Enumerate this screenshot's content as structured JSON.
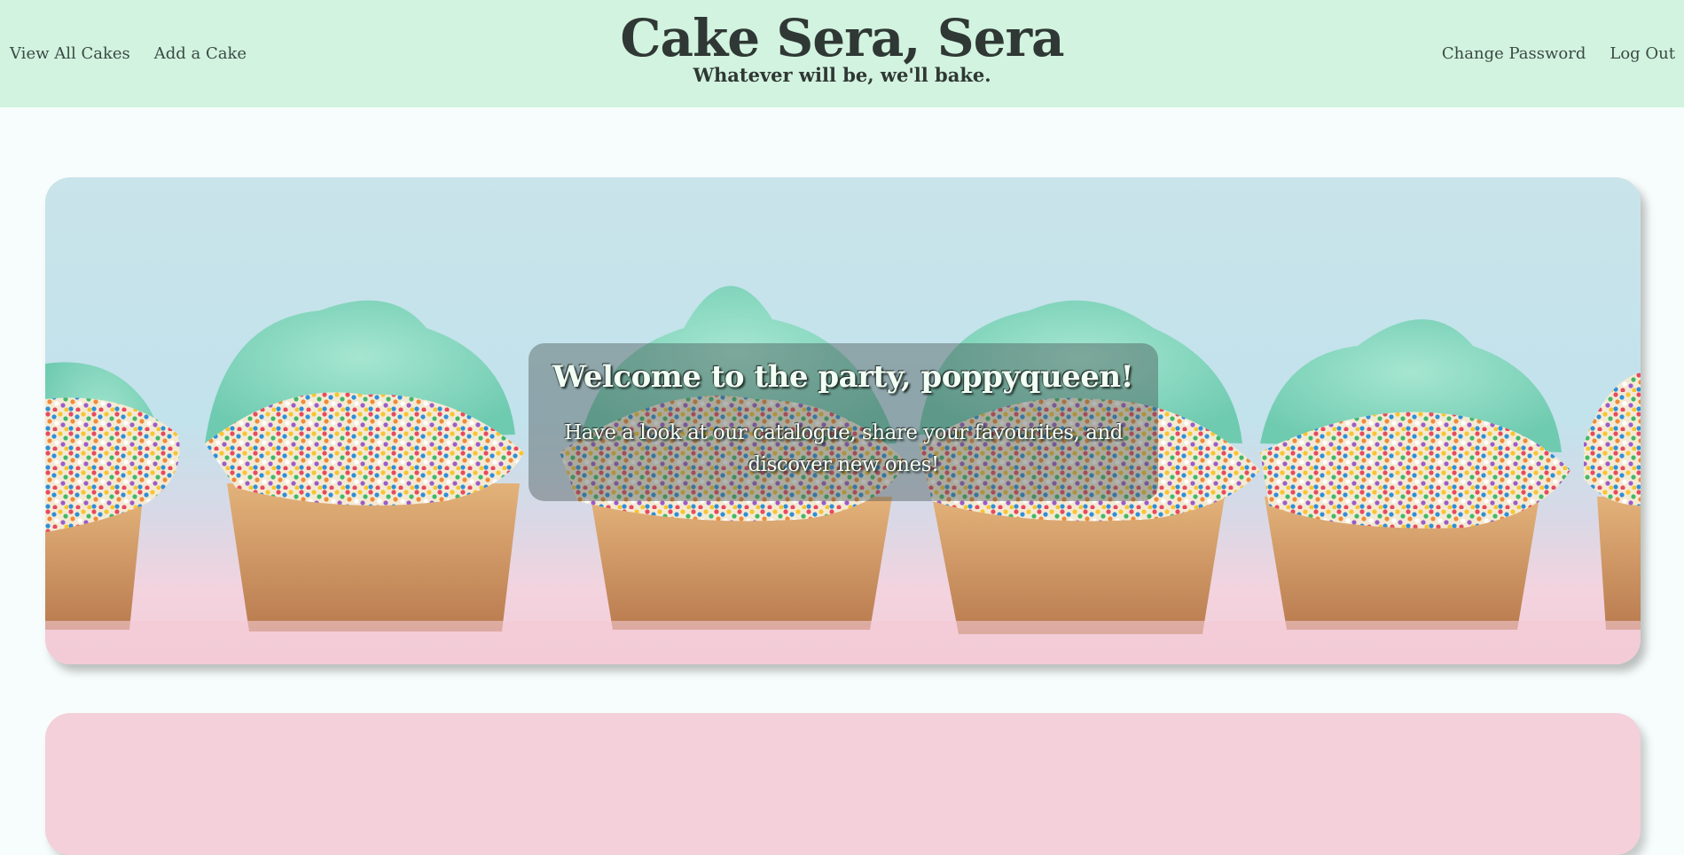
{
  "header": {
    "title": "Cake Sera, Sera",
    "tagline": "Whatever will be, we'll bake.",
    "nav_left": [
      {
        "label": "View All Cakes"
      },
      {
        "label": "Add a Cake"
      }
    ],
    "nav_right": [
      {
        "label": "Change Password"
      },
      {
        "label": "Log Out"
      }
    ]
  },
  "hero": {
    "welcome": "Welcome to the party, poppyqueen!",
    "blurb": "Have a look at our catalogue, share your favourites, and discover new ones!"
  },
  "colors": {
    "header_bg": "#d2f3df",
    "page_bg": "#f7fdfc",
    "card_bg": "#f4d0da",
    "frosting": "#86d8bf",
    "cake_liner": "#d9a36e"
  },
  "icons": {
    "hero_image": "cupcakes-photo"
  }
}
